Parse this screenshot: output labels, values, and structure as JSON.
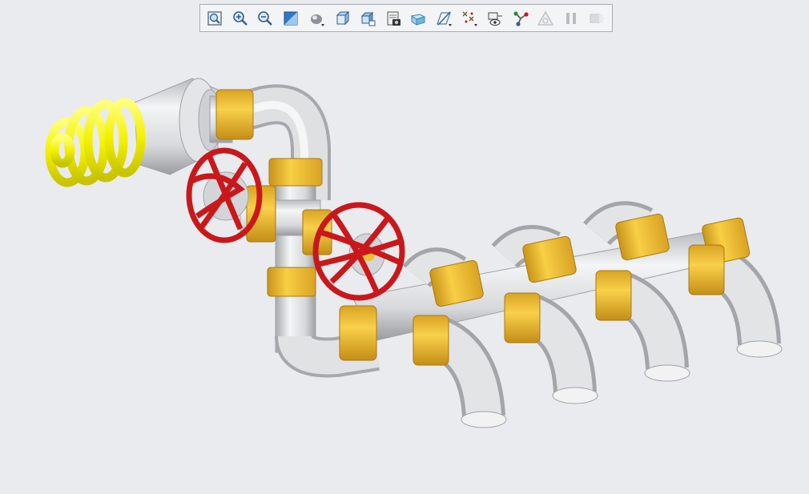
{
  "toolbar": {
    "buttons": [
      {
        "id": "refit",
        "icon": "refit-icon"
      },
      {
        "id": "zoom-in",
        "icon": "zoom-in-icon"
      },
      {
        "id": "zoom-out",
        "icon": "zoom-out-icon"
      },
      {
        "id": "repaint",
        "icon": "repaint-icon"
      },
      {
        "id": "display-style",
        "icon": "display-style-icon"
      },
      {
        "id": "saved-orientations",
        "icon": "saved-orientations-icon"
      },
      {
        "id": "view-manager",
        "icon": "view-manager-icon"
      },
      {
        "id": "section",
        "icon": "section-icon"
      },
      {
        "id": "perspective",
        "icon": "perspective-icon"
      },
      {
        "id": "datum-display",
        "icon": "datum-display-icon"
      },
      {
        "id": "annotation-display",
        "icon": "annotation-display-icon"
      },
      {
        "id": "spin-center",
        "icon": "spin-center-icon"
      },
      {
        "id": "datum-points",
        "icon": "datum-points-icon"
      },
      {
        "id": "appearance",
        "icon": "appearance-icon"
      },
      {
        "id": "pause",
        "icon": "pause-icon"
      },
      {
        "id": "exit",
        "icon": "exit-icon"
      }
    ]
  },
  "colors": {
    "background": "#e9ebee",
    "pipe": "#d9dadc",
    "fitting": "#f0bd2e",
    "valve_handle": "#c9181b",
    "bulb": "#f3f000"
  },
  "scene": {
    "model": "pipe-assembly",
    "parts": [
      "light-bulb",
      "gate-valve-upper",
      "gate-valve-lower",
      "pipe-run",
      "manifold-outlets"
    ]
  }
}
